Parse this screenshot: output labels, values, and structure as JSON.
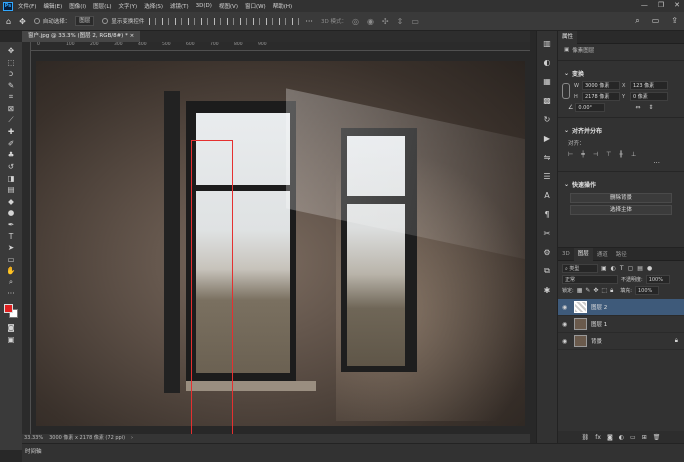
{
  "app": {
    "menu": [
      "文件(F)",
      "编辑(E)",
      "图像(I)",
      "图层(L)",
      "文字(Y)",
      "选择(S)",
      "滤镜(T)",
      "3D(D)",
      "视图(V)",
      "窗口(W)",
      "帮助(H)"
    ],
    "window_controls": [
      "—",
      "❐",
      "✕"
    ]
  },
  "options": {
    "auto_select_label": "自动选择：",
    "auto_select_value": "图层",
    "show_transform_label": "显示变换控件",
    "mode_label": "3D 模式："
  },
  "document": {
    "tab_title": "窗户.jpg @ 33.3% (图层 2, RGB/8#) *",
    "ruler_ticks": [
      "0",
      "100",
      "200",
      "300",
      "400",
      "500",
      "600",
      "700",
      "800",
      "900"
    ],
    "zoom": "33.33%",
    "doc_size": "3000 像素 x 2178 像素 (72 ppi)",
    "timeline_tab": "时间轴"
  },
  "properties": {
    "tabs": [
      "属性"
    ],
    "layer_kind": "像素图层",
    "transform_title": "变换",
    "w_label": "W",
    "w_value": "3000 像素",
    "h_label": "H",
    "h_value": "2178 像素",
    "x_label": "X",
    "x_value": "123 像素",
    "y_label": "Y",
    "y_value": "0 像素",
    "angle": "0.00°",
    "align_title": "对齐并分布",
    "align_to": "对齐：",
    "quick_title": "快速操作",
    "remove_bg": "删除背景",
    "select_subject": "选择主体"
  },
  "layers_panel": {
    "tabs": [
      "3D",
      "图层",
      "通道",
      "路径"
    ],
    "filter_kind": "类型",
    "blend_mode": "正常",
    "opacity_label": "不透明度:",
    "opacity_value": "100%",
    "lock_label": "锁定:",
    "fill_label": "填充:",
    "fill_value": "100%",
    "layers": [
      {
        "name": "图层 2",
        "selected": true
      },
      {
        "name": "图层 1",
        "selected": false
      },
      {
        "name": "背景",
        "selected": false
      }
    ]
  },
  "colors": {
    "foreground": "#e02020",
    "background": "#ffffff",
    "selection": "#e53030",
    "layer_selected": "#3e5a7a"
  }
}
